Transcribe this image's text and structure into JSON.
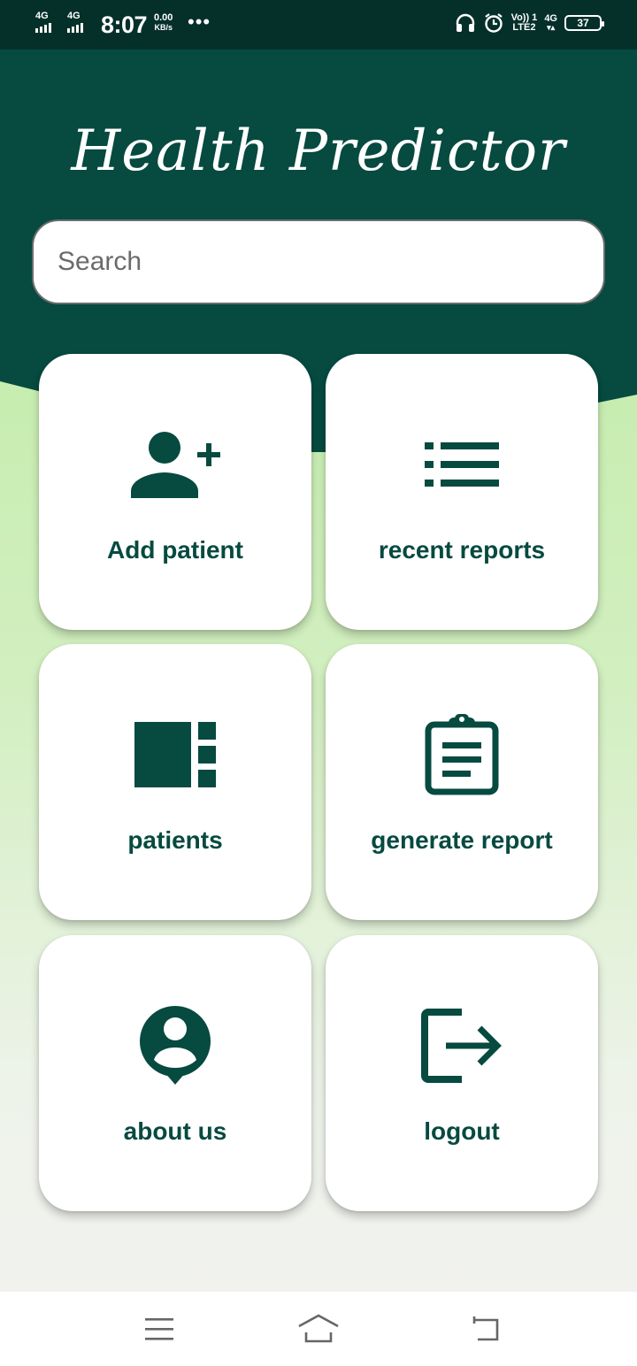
{
  "status_bar": {
    "sim1": "4G",
    "sim2": "4G",
    "time": "8:07",
    "speed_value": "0.00",
    "speed_unit": "KB/s",
    "more": "•••",
    "volte_top": "Vo)) 1",
    "volte_bottom": "LTE2",
    "net_type": "4G",
    "battery": "37"
  },
  "app": {
    "title": "Health Predictor",
    "search_placeholder": "Search"
  },
  "menu": [
    {
      "label": "Add patient",
      "icon": "add-person-icon"
    },
    {
      "label": "recent reports",
      "icon": "list-icon"
    },
    {
      "label": "patients",
      "icon": "view-sidebar-icon"
    },
    {
      "label": "generate report",
      "icon": "clipboard-icon"
    },
    {
      "label": "about us",
      "icon": "person-pin-icon"
    },
    {
      "label": "logout",
      "icon": "logout-icon"
    }
  ],
  "colors": {
    "primary": "#064a40",
    "status_bar": "#05302a",
    "gradient_top": "#b9ea9c",
    "card": "#ffffff"
  },
  "nav_bar": {
    "icons": [
      "menu-icon",
      "home-icon",
      "back-icon"
    ]
  }
}
